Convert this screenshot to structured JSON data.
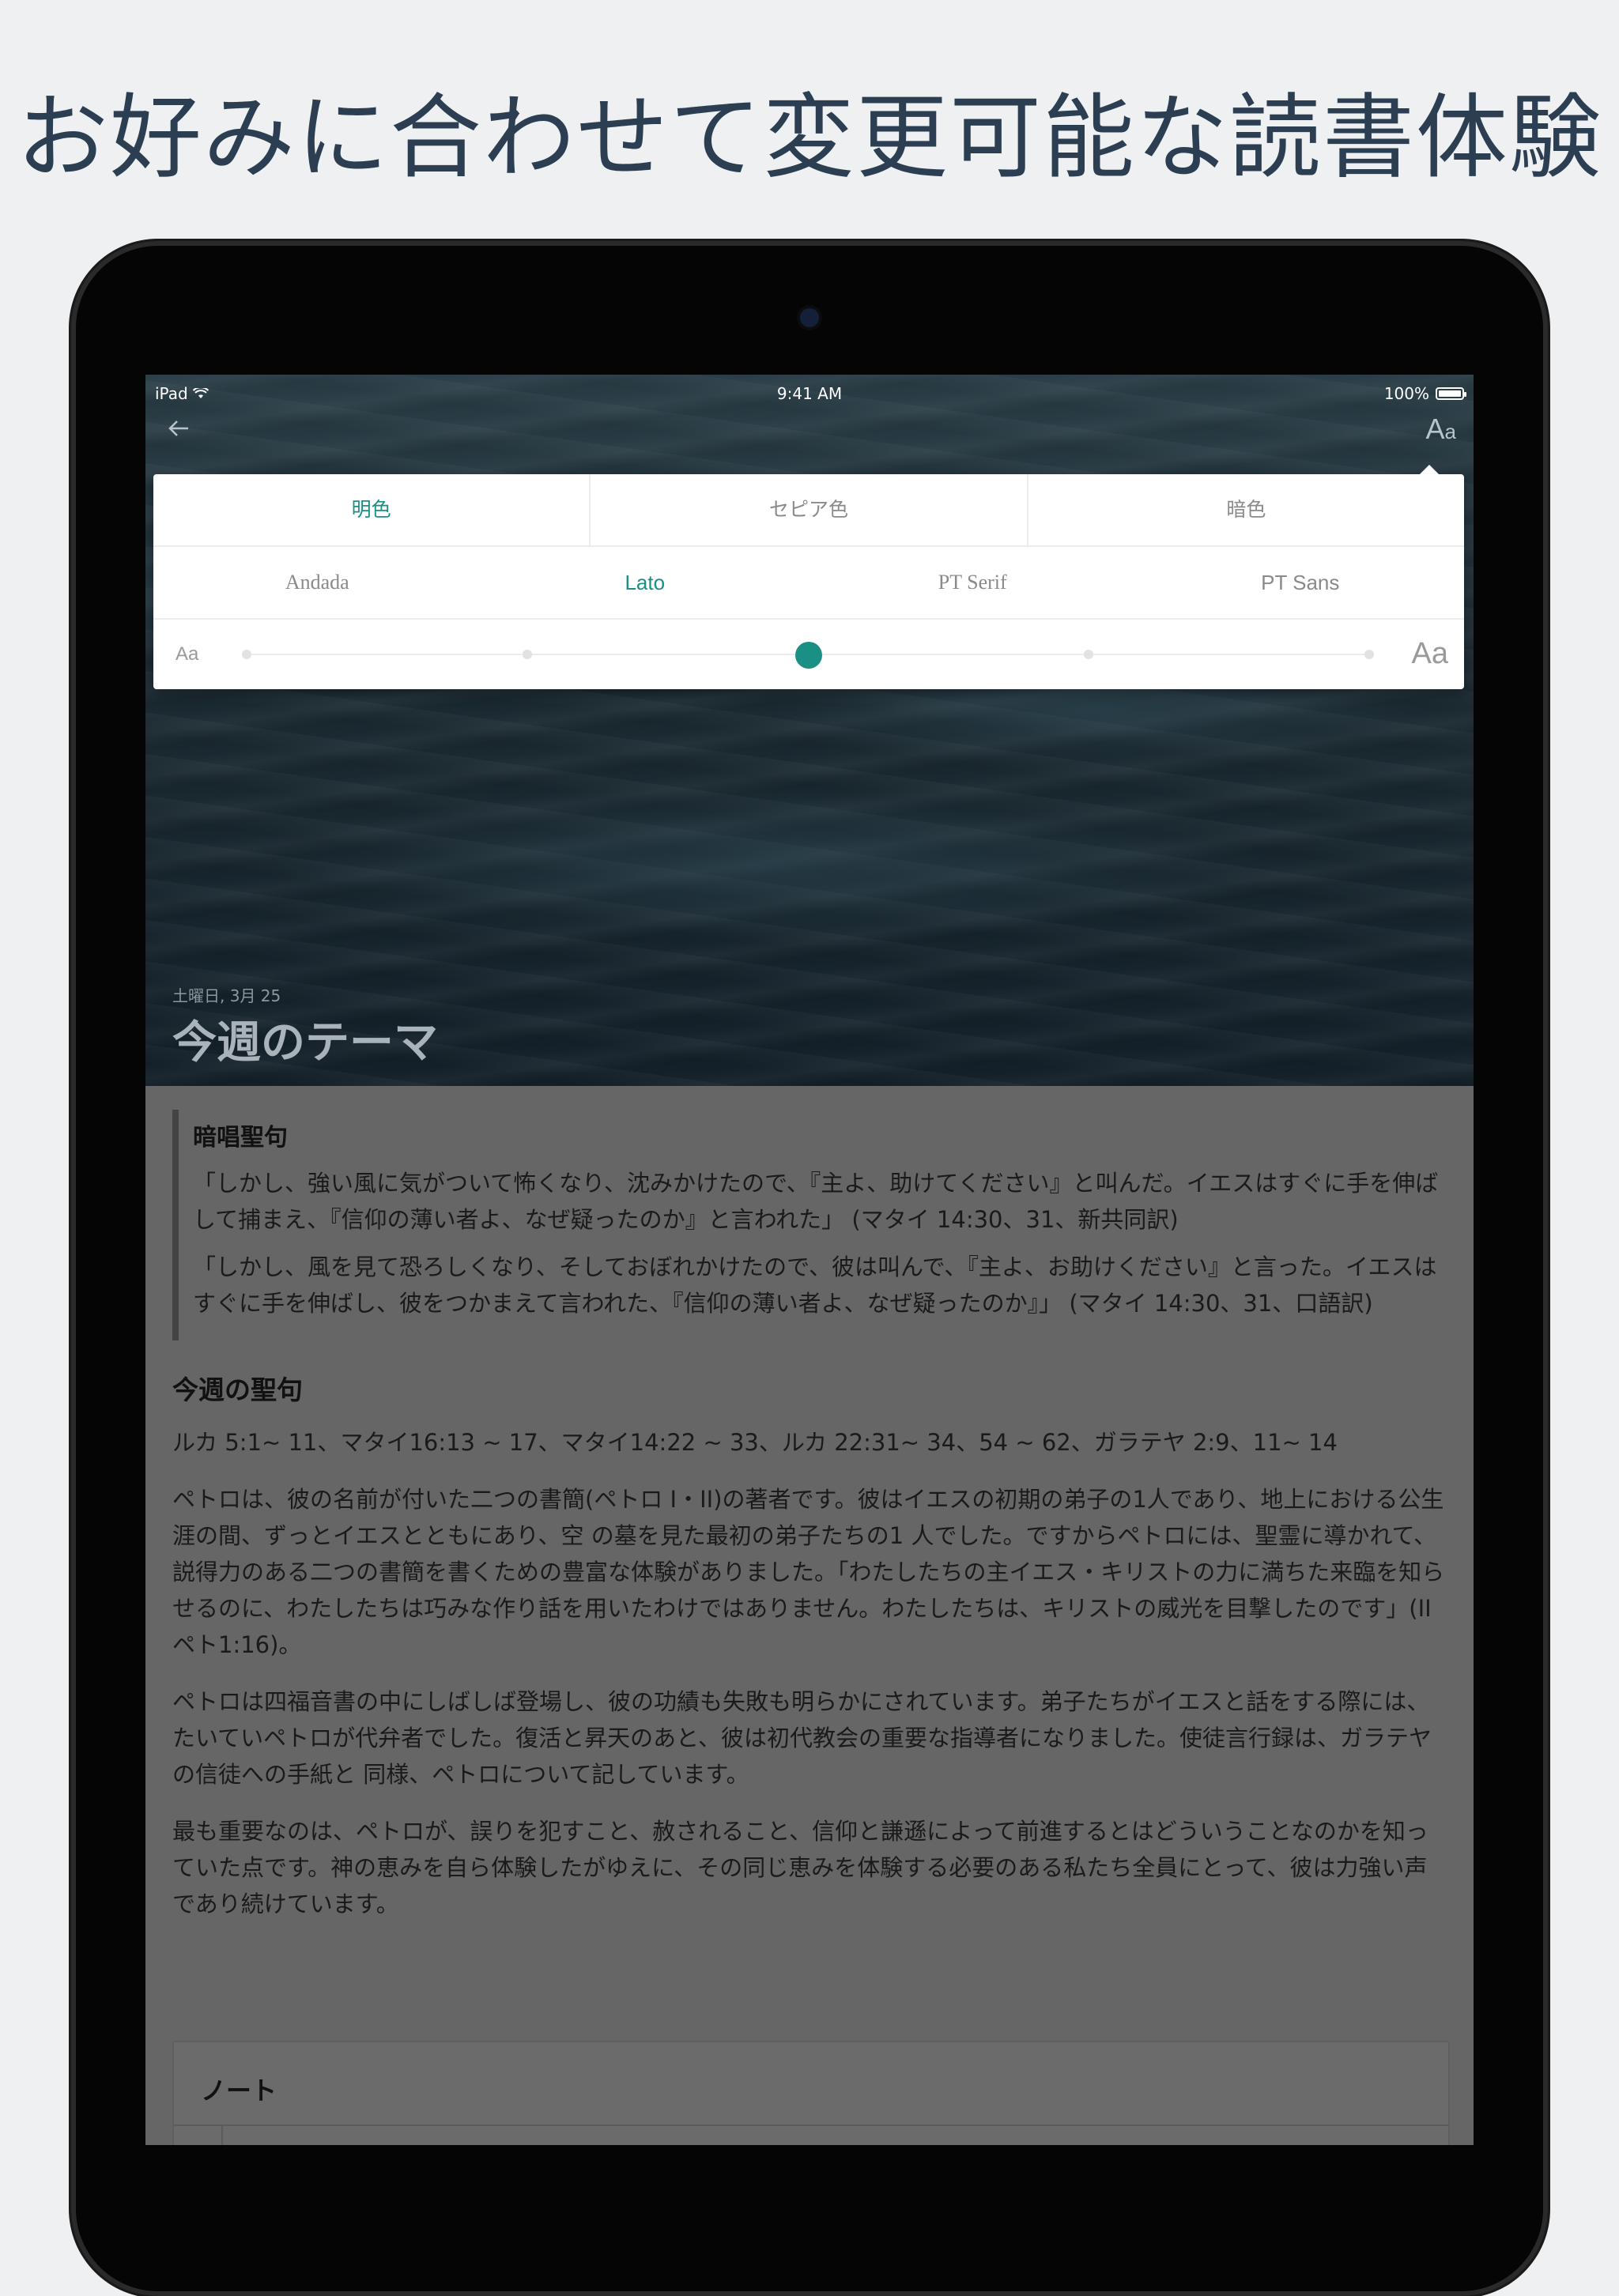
{
  "headline": "お好みに合わせて変更可能な読書体験",
  "status": {
    "carrier": "iPad",
    "time": "9:41 AM",
    "battery": "100%"
  },
  "nav": {
    "font_icon_big": "A",
    "font_icon_small": "a"
  },
  "settings": {
    "themes": [
      {
        "label": "明色",
        "active": true
      },
      {
        "label": "セピア色",
        "active": false
      },
      {
        "label": "暗色",
        "active": false
      }
    ],
    "fonts": [
      {
        "label": "Andada",
        "active": false
      },
      {
        "label": "Lato",
        "active": true
      },
      {
        "label": "PT Serif",
        "active": false
      },
      {
        "label": "PT Sans",
        "active": false
      }
    ],
    "size": {
      "small_label": "Aa",
      "large_label": "Aa",
      "levels": 5,
      "selected_index": 2
    },
    "accent_color": "#1a8f84"
  },
  "lesson": {
    "date": "土曜日, 3月 25",
    "title": "今週のテーマ",
    "memory": {
      "heading": "暗唱聖句",
      "p1": "「しかし、強い風に気がついて怖くなり、沈みかけたので、『主よ、助けてください』と叫んだ。イエスはすぐに手を伸ばして捕まえ、『信仰の薄い者よ、なぜ疑ったのか』と言われた」 (マタイ 14:30、31、新共同訳)",
      "p2": "「しかし、風を見て恐ろしくなり、そしておぼれかけたので、彼は叫んで、『主よ、お助けください』と言った。イエスはすぐに手を伸ばし、彼をつかまえて言われた、『信仰の薄い者よ、なぜ疑ったのか』」 (マタイ 14:30、31、口語訳)"
    },
    "readings_heading": "今週の聖句",
    "readings": "ルカ 5:1~ 11、マタイ16:13 ~ 17、マタイ14:22 ~ 33、ルカ 22:31~ 34、54 ~ 62、ガラテヤ 2:9、11~ 14",
    "para1": "ペトロは、彼の名前が付いた二つの書簡(ペトロ I・II)の著者です。彼はイエスの初期の弟子の1人であり、地上における公生涯の間、ずっとイエスとともにあり、空 の墓を見た最初の弟子たちの1 人でした。ですからペトロには、聖霊に導かれて、説得力のある二つの書簡を書くための豊富な体験がありました。「わたしたちの主イエス・キリストの力に満ちた来臨を知らせるのに、わたしたちは巧みな作り話を用いたわけではありません。わたしたちは、キリストの威光を目撃したのです」(IIペト1:16)。",
    "para2": "ペトロは四福音書の中にしばしば登場し、彼の功績も失敗も明らかにされています。弟子たちがイエスと話をする際には、たいていペトロが代弁者でした。復活と昇天のあと、彼は初代教会の重要な指導者になりました。使徒言行録は、ガラテヤの信徒への手紙と 同様、ペトロについて記しています。",
    "para3": "最も重要なのは、ペトロが、誤りを犯すこと、赦されること、信仰と謙遜によって前進するとはどういうことなのかを知っていた点です。神の恵みを自ら体験したがゆえに、その同じ恵みを体験する必要のある私たち全員にとって、彼は力強い声であり続けています。",
    "notes_heading": "ノート"
  }
}
